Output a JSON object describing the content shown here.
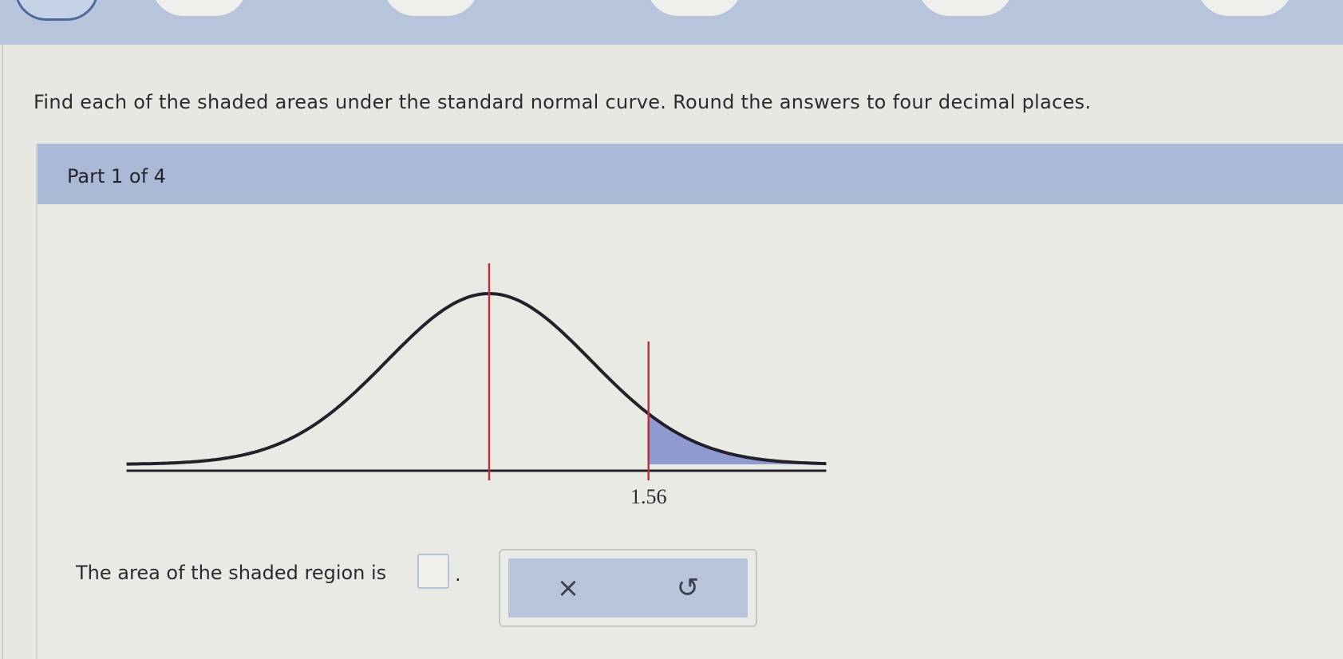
{
  "prompt": "Find each of the shaded areas under the standard normal curve. Round the answers to four decimal places.",
  "part": {
    "label": "Part 1 of 4"
  },
  "graph": {
    "shaded_tail": "right",
    "z_value": 1.56,
    "tick_label": "1.56",
    "curve_color": "#23202a",
    "marker_color": "#c0303c",
    "shade_color": "#8f9ad0"
  },
  "answer": {
    "label": "The area of the shaded region is",
    "value": "",
    "trailing": "."
  },
  "tools": {
    "clear_icon": "×",
    "undo_icon": "↺"
  },
  "colors": {
    "header_bar": "#a9b9d6",
    "background": "#e6e8e2"
  }
}
